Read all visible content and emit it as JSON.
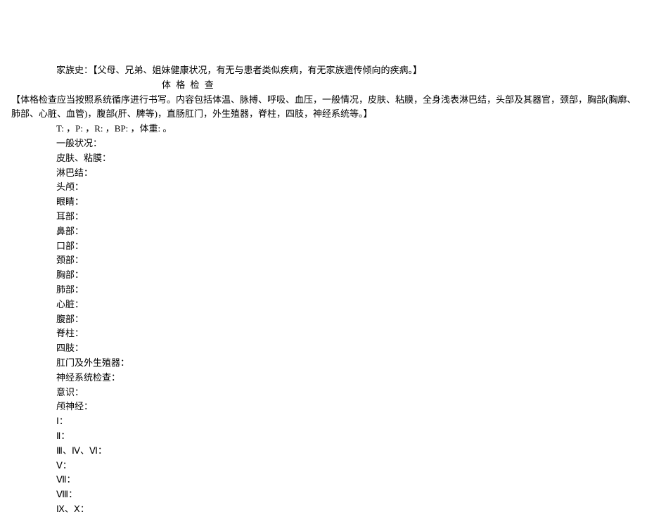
{
  "family_history": {
    "label": "家族史：",
    "content": "【父母、兄弟、姐妹健康状况，有无与患者类似疾病，有无家族遗传倾向的疾病。】"
  },
  "section_title": "体 格 检 查",
  "exam_intro": "【体格检查应当按照系统循序进行书写。内容包括体温、脉搏、呼吸、血压，一般情况，皮肤、粘膜，全身浅表淋巴结，头部及其器官，颈部，胸部(胸廓、肺部、心脏、血管)，腹部(肝、脾等)，直肠肛门，外生殖器，脊柱，四肢，神经系统等。】",
  "vitals": "T:    ，P:    ，R:    ，BP:  ，体重:      。",
  "items": {
    "general": "一般状况：",
    "skin": "皮肤、粘膜：",
    "lymph": "淋巴结：",
    "head": "头颅：",
    "eyes": "眼睛：",
    "ears": "耳部：",
    "nose": "鼻部：",
    "mouth": "口部：",
    "neck": "颈部：",
    "chest": "胸部：",
    "lung": "肺部：",
    "heart": "心脏：",
    "abdomen": "腹部：",
    "spine": "脊柱：",
    "limbs": "四肢：",
    "anus": "肛门及外生殖器：",
    "neuro_exam": "神经系统检查：",
    "consciousness": "意识：",
    "cranial": "颅神经：",
    "cn1": "Ⅰ：",
    "cn2": "Ⅱ：",
    "cn346": "Ⅲ、Ⅳ、Ⅵ：",
    "cn5": "Ⅴ：",
    "cn7": "Ⅶ：",
    "cn8": "Ⅷ：",
    "cn910": "Ⅸ、Ⅹ："
  }
}
